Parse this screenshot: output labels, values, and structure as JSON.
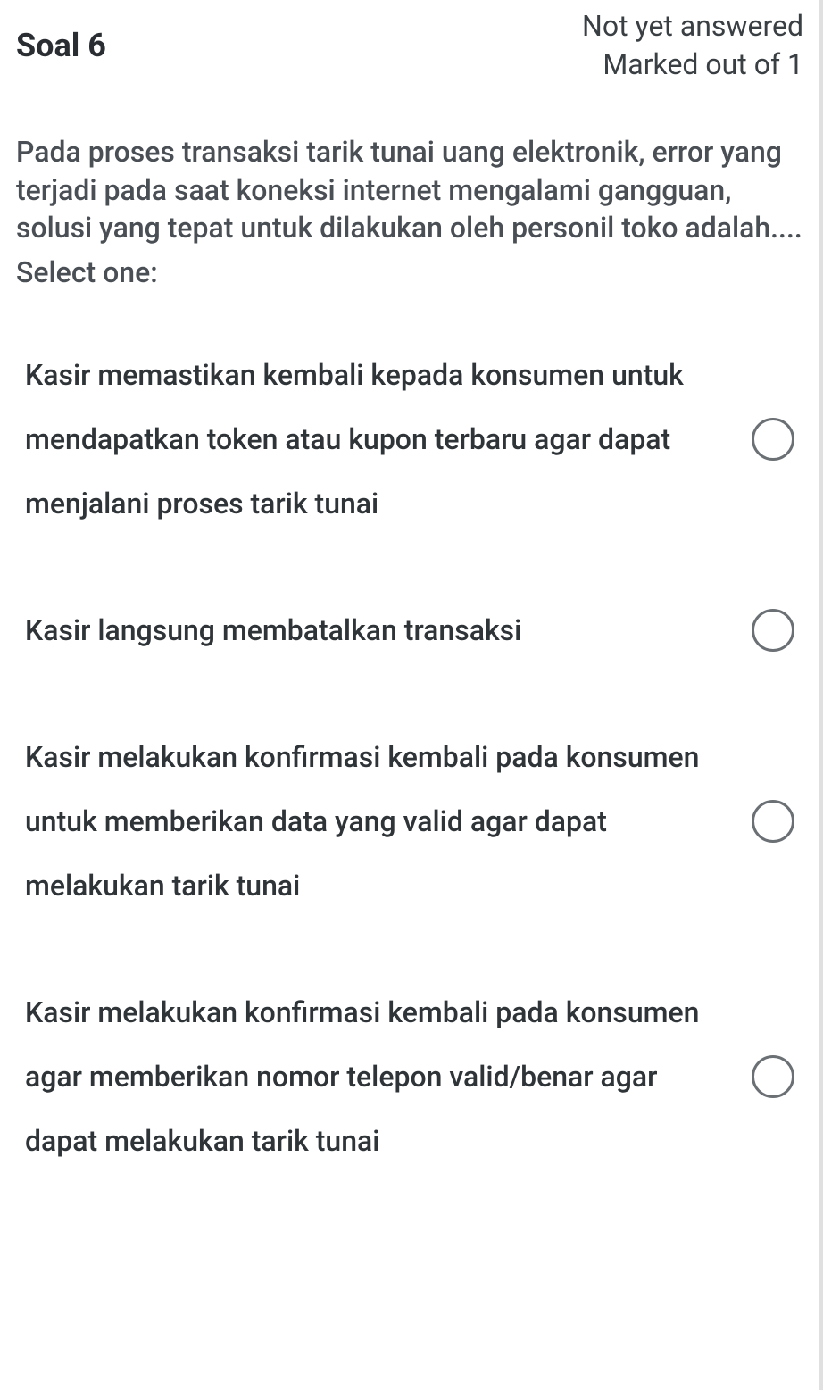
{
  "header": {
    "question_label": "Soal 6",
    "status_line1": "Not yet answered",
    "status_line2": "Marked out of 1"
  },
  "question": {
    "text": "Pada proses transaksi tarik tunai uang elektronik, error yang terjadi pada saat koneksi internet mengalami gangguan, solusi yang tepat untuk dilakukan oleh personil toko adalah....",
    "select_label": "Select one:"
  },
  "options": [
    {
      "text": "Kasir memastikan kembali kepada konsumen untuk mendapatkan token atau kupon terbaru agar dapat menjalani proses tarik tunai"
    },
    {
      "text": "Kasir langsung membatalkan transaksi"
    },
    {
      "text": "Kasir melakukan konfirmasi kembali pada konsumen untuk memberikan data yang valid agar dapat melakukan tarik tunai"
    },
    {
      "text": "Kasir melakukan konfirmasi kembali pada konsumen agar memberikan nomor telepon valid/benar agar dapat melakukan tarik tunai"
    }
  ]
}
